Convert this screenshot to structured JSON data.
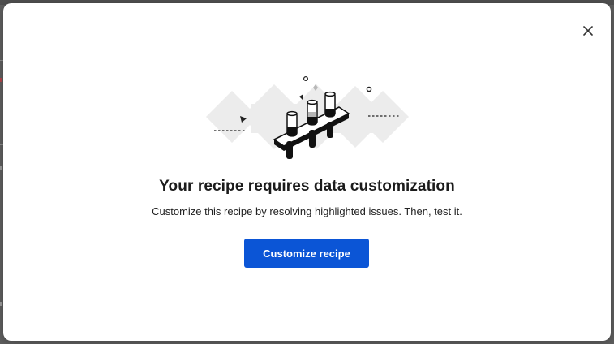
{
  "modal": {
    "title": "Your recipe requires data customization",
    "subtitle": "Customize this recipe by resolving highlighted issues. Then, test it.",
    "primary_button_label": "Customize recipe",
    "close_icon": "close-icon",
    "illustration_icon": "test-tubes-rack-illustration"
  },
  "colors": {
    "primary": "#0b55d6",
    "title": "#1b1b1b",
    "overlay": "#5e5e5e"
  }
}
